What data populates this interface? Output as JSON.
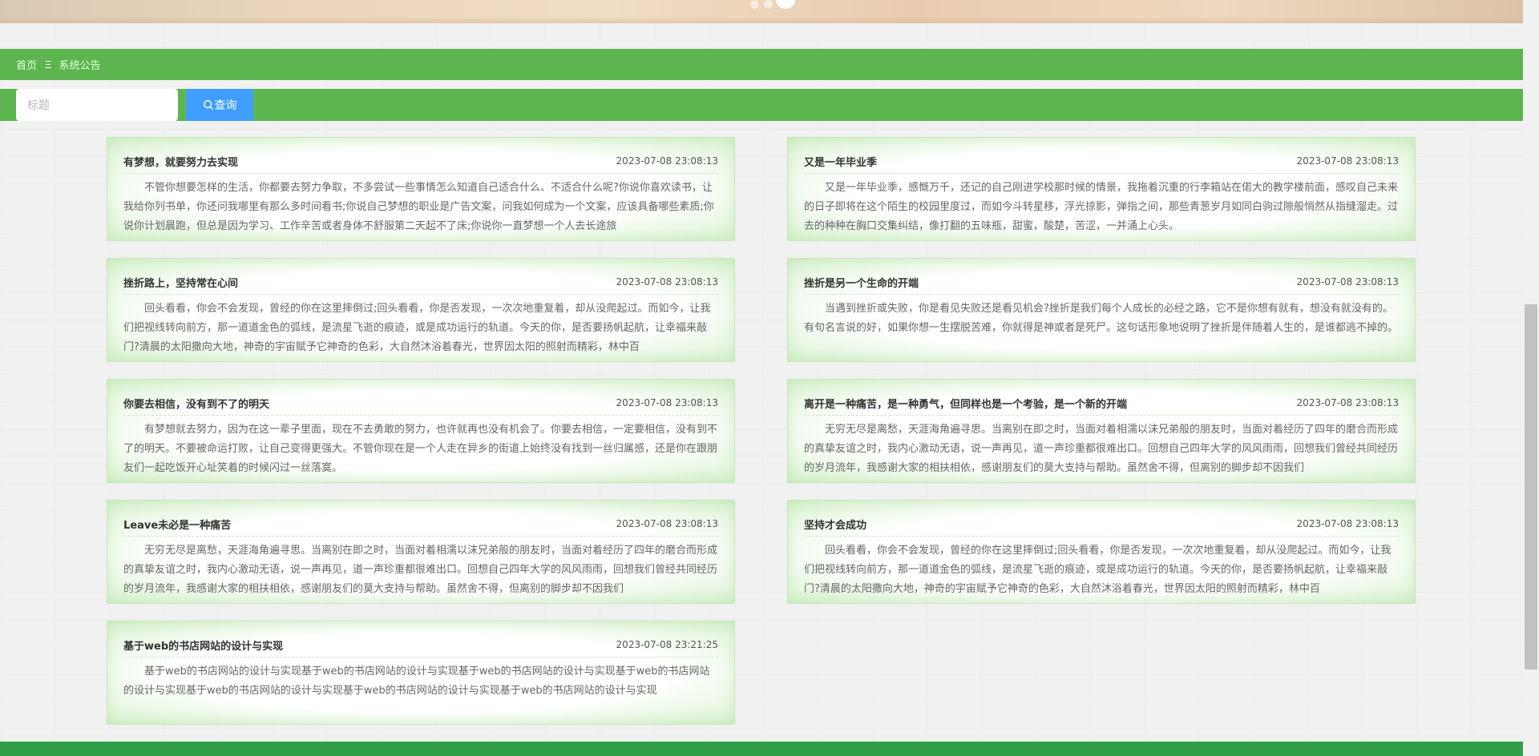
{
  "carousel": {
    "dot_count": 3,
    "active_index": 2
  },
  "breadcrumb": {
    "home": "首页",
    "separator": "Ξ",
    "current": "系统公告"
  },
  "search": {
    "placeholder": "标题",
    "value": "",
    "button_label": "查询"
  },
  "notices": [
    {
      "title": "有梦想，就要努力去实现",
      "time": "2023-07-08 23:08:13",
      "content": "不管你想要怎样的生活，你都要去努力争取，不多尝试一些事情怎么知道自己适合什么、不适合什么呢?你说你喜欢读书，让我给你列书单，你还问我哪里有那么多时间看书;你说自己梦想的职业是广告文案，问我如何成为一个文案，应该具备哪些素质;你说你计划晨跑，但总是因为学习、工作辛苦或者身体不舒服第二天起不了床;你说你一直梦想一个人去长途旅"
    },
    {
      "title": "又是一年毕业季",
      "time": "2023-07-08 23:08:13",
      "content": "又是一年毕业季，感慨万千，还记的自己刚进学校那时候的情景，我拖着沉重的行李箱站在偌大的教学楼前面，感叹自己未来的日子即将在这个陌生的校园里度过，而如今斗转星移，浮光掠影，弹指之间，那些青葱岁月如同白驹过隙般悄然从指缝溜走。过去的种种在胸口交集纠结，像打翻的五味瓶，甜蜜，酸楚，苦涩，一并涌上心头。"
    },
    {
      "title": "挫折路上，坚持常在心间",
      "time": "2023-07-08 23:08:13",
      "content": "回头看看，你会不会发现，曾经的你在这里摔倒过;回头看看，你是否发现，一次次地重复着，却从没爬起过。而如今，让我们把视线转向前方，那一道道金色的弧线，是流星飞逝的痕迹，或是成功运行的轨道。今天的你，是否要扬帆起航，让幸福来敲门?清晨的太阳撒向大地，神奇的宇宙赋予它神奇的色彩，大自然沐浴着春光，世界因太阳的照射而精彩，林中百"
    },
    {
      "title": "挫折是另一个生命的开端",
      "time": "2023-07-08 23:08:13",
      "content": "当遇到挫折或失败，你是看见失败还是看见机会?挫折是我们每个人成长的必经之路，它不是你想有就有，想没有就没有的。有句名言说的好，如果你想一生摆脱苦难，你就得是神或者是死尸。这句话形象地说明了挫折是伴随着人生的，是谁都逃不掉的。"
    },
    {
      "title": "你要去相信，没有到不了的明天",
      "time": "2023-07-08 23:08:13",
      "content": "有梦想就去努力，因为在这一辈子里面，现在不去勇敢的努力，也许就再也没有机会了。你要去相信，一定要相信，没有到不了的明天。不要被命运打败，让自己变得更强大。不管你现在是一个人走在异乡的街道上始终没有找到一丝归属感，还是你在跟朋友们一起吃饭开心址笑着的时候闪过一丝落寞。"
    },
    {
      "title": "离开是一种痛苦，是一种勇气，但同样也是一个考验，是一个新的开端",
      "time": "2023-07-08 23:08:13",
      "content": "无穷无尽是离愁，天涯海角遍寻思。当离别在即之时，当面对着相濡以沫兄弟般的朋友时，当面对着经历了四年的磨合而形成的真挚友谊之时，我内心激动无语，说一声再见，道一声珍重都很难出口。回想自己四年大学的风风雨雨，回想我们曾经共同经历的岁月流年，我感谢大家的相扶相依，感谢朋友们的莫大支持与帮助。虽然舍不得，但离别的脚步却不因我们"
    },
    {
      "title": "Leave未必是一种痛苦",
      "time": "2023-07-08 23:08:13",
      "content": "无穷无尽是离愁，天涯海角遍寻思。当离别在即之时，当面对着相濡以沫兄弟般的朋友时，当面对着经历了四年的磨合而形成的真挚友谊之时，我内心激动无语，说一声再见，道一声珍重都很难出口。回想自己四年大学的风风雨雨，回想我们曾经共同经历的岁月流年，我感谢大家的相扶相依，感谢朋友们的莫大支持与帮助。虽然舍不得，但离别的脚步却不因我们"
    },
    {
      "title": "坚持才会成功",
      "time": "2023-07-08 23:08:13",
      "content": "回头看看，你会不会发现，曾经的你在这里摔倒过;回头看看，你是否发现，一次次地重复着，却从没爬起过。而如今，让我们把视线转向前方，那一道道金色的弧线，是流星飞逝的痕迹，或是成功运行的轨道。今天的你，是否要扬帆起航，让幸福来敲门?清晨的太阳撒向大地，神奇的宇宙赋予它神奇的色彩，大自然沐浴着春光，世界因太阳的照射而精彩，林中百"
    },
    {
      "title": "基于web的书店网站的设计与实现",
      "time": "2023-07-08 23:21:25",
      "content": "基于web的书店网站的设计与实现基于web的书店网站的设计与实现基于web的书店网站的设计与实现基于web的书店网站的设计与实现基于web的书店网站的设计与实现基于web的书店网站的设计与实现基于web的书店网站的设计与实现"
    }
  ]
}
